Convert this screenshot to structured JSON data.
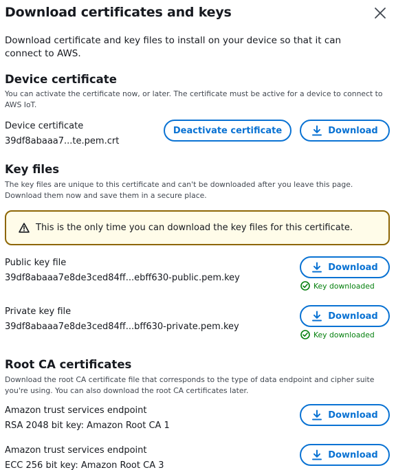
{
  "modal": {
    "title": "Download certificates and keys",
    "intro": "Download certificate and key files to install on your device so that it can connect to AWS."
  },
  "device_certificate": {
    "heading": "Device certificate",
    "description": "You can activate the certificate now, or later. The certificate must be active for a device to connect to AWS IoT.",
    "label": "Device certificate",
    "filename": "39df8abaaa7...te.pem.crt",
    "deactivate_label": "Deactivate certificate",
    "download_label": "Download"
  },
  "key_files": {
    "heading": "Key files",
    "description": "The key files are unique to this certificate and can't be downloaded after you leave this page. Download them now and save them in a secure place.",
    "alert": "This is the only time you can download the key files for this certificate.",
    "public": {
      "label": "Public key file",
      "filename": "39df8abaaa7e8de3ced84ff...ebff630-public.pem.key",
      "download_label": "Download",
      "status": "Key downloaded"
    },
    "private": {
      "label": "Private key file",
      "filename": "39df8abaaa7e8de3ced84ff...bff630-private.pem.key",
      "download_label": "Download",
      "status": "Key downloaded"
    }
  },
  "root_ca": {
    "heading": "Root CA certificates",
    "description": "Download the root CA certificate file that corresponds to the type of data endpoint and cipher suite you're using. You can also download the root CA certificates later.",
    "items": [
      {
        "label": "Amazon trust services endpoint",
        "value": "RSA 2048 bit key: Amazon Root CA 1",
        "download_label": "Download"
      },
      {
        "label": "Amazon trust services endpoint",
        "value": "ECC 256 bit key: Amazon Root CA 3",
        "download_label": "Download"
      }
    ]
  },
  "colors": {
    "accent": "#0972d3",
    "success": "#037f0c",
    "warning_border": "#8d6605",
    "warning_bg": "#fffce9"
  },
  "icons": [
    "close-icon",
    "download-icon",
    "warning-icon",
    "check-circle-icon"
  ]
}
